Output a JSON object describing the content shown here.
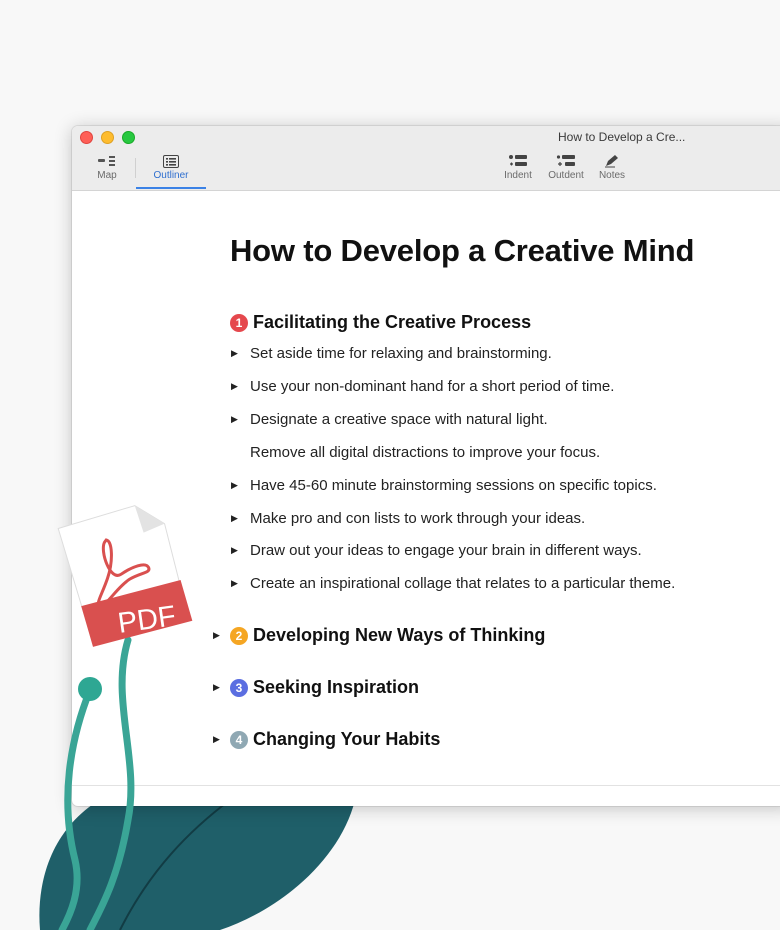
{
  "window": {
    "title": "How to Develop a Cre..."
  },
  "toolbar": {
    "map_label": "Map",
    "outliner_label": "Outliner",
    "indent_label": "Indent",
    "outdent_label": "Outdent",
    "notes_label": "Notes"
  },
  "document": {
    "title": "How to Develop a Creative Mind",
    "sections": [
      {
        "number": "1",
        "label": "Facilitating the Creative Process",
        "color": "#e5484d"
      },
      {
        "number": "2",
        "label": "Developing New Ways of Thinking",
        "color": "#f5a623"
      },
      {
        "number": "3",
        "label": "Seeking Inspiration",
        "color": "#5b6ee1"
      },
      {
        "number": "4",
        "label": "Changing Your Habits",
        "color": "#8fa8b3"
      }
    ],
    "items": [
      "Set aside time for relaxing and brainstorming.",
      "Use your non-dominant hand for a short period of time.",
      "Designate a creative space with natural light.",
      "Remove all digital distractions to improve your focus.",
      "Have 45-60 minute brainstorming sessions on specific topics.",
      "Make pro and con lists to work through your ideas.",
      "Draw out your ideas to engage your brain in different ways.",
      "Create an inspirational collage that relates to a particular theme."
    ]
  },
  "pdf_badge": {
    "label": "PDF",
    "color": "#d9504f"
  },
  "icons": {
    "map": "map-icon",
    "outliner": "outliner-icon",
    "indent": "indent-icon",
    "outdent": "outdent-icon",
    "notes": "notes-icon",
    "pdf": "pdf-file-icon"
  }
}
